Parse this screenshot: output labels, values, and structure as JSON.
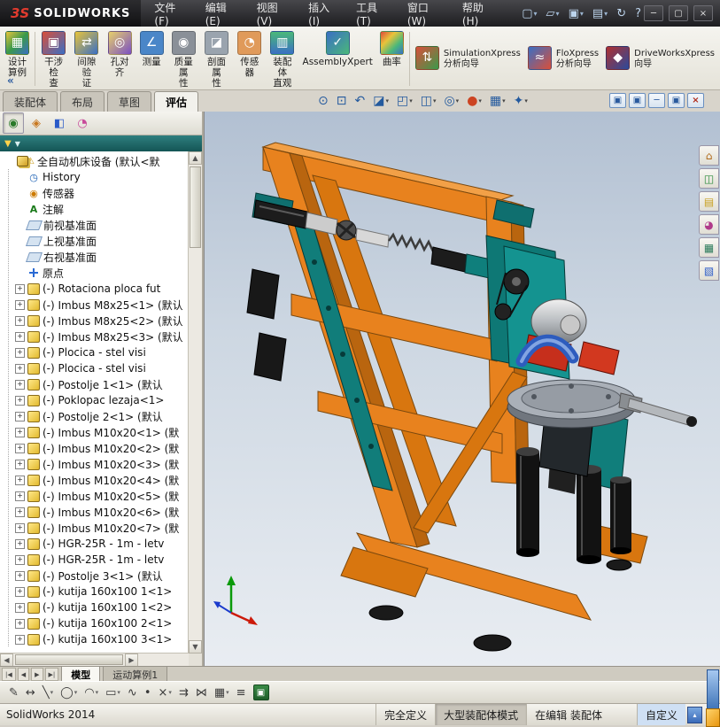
{
  "window": {
    "logo_mark": "3S",
    "logo_text": "SOLIDWORKS",
    "menus": [
      "文件(F)",
      "编辑(E)",
      "视图(V)",
      "插入(I)",
      "工具(T)",
      "窗口(W)",
      "帮助(H)"
    ],
    "quick_icons": [
      {
        "name": "new-document-button",
        "glyph": "▢",
        "caret": "▾"
      },
      {
        "name": "open-button",
        "glyph": "▱",
        "caret": "▾"
      },
      {
        "name": "save-button",
        "glyph": "▣",
        "caret": "▾"
      },
      {
        "name": "print-button",
        "glyph": "▤",
        "caret": "▾"
      },
      {
        "name": "rebuild-button",
        "glyph": "↻",
        "caret": ""
      },
      {
        "name": "help-button",
        "glyph": "?",
        "caret": ""
      }
    ],
    "window_buttons": [
      {
        "name": "minimize-button",
        "glyph": "─"
      },
      {
        "name": "maximize-button",
        "glyph": "▢"
      },
      {
        "name": "close-button",
        "glyph": "×"
      }
    ]
  },
  "ribbon": {
    "design_study": {
      "name": "design-study-button",
      "icon": "design-study-icon",
      "glyph": "▦",
      "label": "设计\n算例"
    },
    "collapse_glyph": "«",
    "buttons": [
      {
        "name": "interference-check-button",
        "icon": "interference-check-icon",
        "glyph": "▣",
        "label": "干涉检\n查"
      },
      {
        "name": "clearance-verify-button",
        "icon": "clearance-verify-icon",
        "glyph": "⇄",
        "label": "间隙验\n证"
      },
      {
        "name": "hole-alignment-button",
        "icon": "hole-alignment-icon",
        "glyph": "◎",
        "label": "孔对齐"
      },
      {
        "name": "measure-button",
        "icon": "measure-icon",
        "glyph": "∠",
        "label": "测量"
      },
      {
        "name": "mass-properties-button",
        "icon": "mass-properties-icon",
        "glyph": "◉",
        "label": "质量属\n性"
      },
      {
        "name": "section-properties-button",
        "icon": "section-properties-icon",
        "glyph": "◪",
        "label": "剖面属\n性"
      },
      {
        "name": "sensor-button",
        "icon": "sensor-icon",
        "glyph": "◔",
        "label": "传感器"
      },
      {
        "name": "assembly-visualization-button",
        "icon": "assembly-visualization-icon",
        "glyph": "▥",
        "label": "装配体\n直观"
      },
      {
        "name": "assemblyxpert-button",
        "icon": "assemblyxpert-icon",
        "glyph": "✓",
        "label": "AssemblyXpert"
      },
      {
        "name": "curvature-button",
        "icon": "curvature-icon",
        "glyph": "",
        "label": "曲率"
      }
    ],
    "xpress": [
      {
        "name": "simulationxpress-button",
        "icon": "simulationxpress-icon",
        "glyph": "⇅",
        "label": "SimulationXpress\n分析向导"
      },
      {
        "name": "floxpress-button",
        "icon": "floxpress-icon",
        "glyph": "≈",
        "label": "FloXpress\n分析向导"
      },
      {
        "name": "driveworksxpress-button",
        "icon": "driveworksxpress-icon",
        "glyph": "◆",
        "label": "DriveWorksXpress\n向导"
      }
    ]
  },
  "tabs": {
    "items": [
      {
        "name": "tab-assembly",
        "label": "装配体",
        "cls": ""
      },
      {
        "name": "tab-layout",
        "label": "布局",
        "cls": ""
      },
      {
        "name": "tab-sketch",
        "label": "草图",
        "cls": ""
      },
      {
        "name": "tab-evaluate",
        "label": "评估",
        "cls": "active"
      }
    ]
  },
  "viewport": {
    "hud": [
      {
        "name": "zoom-to-fit-button",
        "glyph": "⊙",
        "caret": "",
        "cls": ""
      },
      {
        "name": "zoom-to-area-button",
        "glyph": "⊡",
        "caret": "",
        "cls": ""
      },
      {
        "name": "previous-view-button",
        "glyph": "↶",
        "caret": "",
        "cls": ""
      },
      {
        "name": "section-view-button",
        "glyph": "◪",
        "caret": "▾",
        "cls": ""
      },
      {
        "name": "view-orientation-button",
        "glyph": "◰",
        "caret": "▾",
        "cls": ""
      },
      {
        "name": "display-style-button",
        "glyph": "◫",
        "caret": "▾",
        "cls": ""
      },
      {
        "name": "hide-show-items-button",
        "glyph": "◎",
        "caret": "▾",
        "cls": ""
      },
      {
        "name": "edit-appearance-button",
        "glyph": "●",
        "caret": "▾",
        "cls": "ball"
      },
      {
        "name": "apply-scene-button",
        "glyph": "▦",
        "caret": "▾",
        "cls": ""
      },
      {
        "name": "view-settings-button",
        "glyph": "✦",
        "caret": "▾",
        "cls": ""
      }
    ],
    "doc_buttons": [
      {
        "name": "restore-doc-button",
        "glyph": "▣",
        "cls": ""
      },
      {
        "name": "tile-doc-button",
        "glyph": "▣",
        "cls": ""
      },
      {
        "name": "minimize-doc-button",
        "glyph": "─",
        "cls": ""
      },
      {
        "name": "maximize-doc-button",
        "glyph": "▣",
        "cls": ""
      },
      {
        "name": "close-doc-button",
        "glyph": "×",
        "cls": "close"
      }
    ],
    "taskpane": [
      {
        "name": "solidworks-resources-tab",
        "glyph": "⌂",
        "cls": "tp1"
      },
      {
        "name": "design-library-tab",
        "glyph": "◫",
        "cls": "tp2"
      },
      {
        "name": "file-explorer-tab",
        "glyph": "▤",
        "cls": "tp3"
      },
      {
        "name": "appearances-tab",
        "glyph": "◕",
        "cls": "tp4"
      },
      {
        "name": "custom-properties-tab",
        "glyph": "▦",
        "cls": "tp5"
      },
      {
        "name": "view-palette-tab",
        "glyph": "▧",
        "cls": "tp6"
      }
    ]
  },
  "panel": {
    "tabs": [
      {
        "name": "featuremanager-tree-tab",
        "glyph": "◉",
        "cls": "c-green"
      },
      {
        "name": "propertymanager-tab",
        "glyph": "◈",
        "cls": "c-orange"
      },
      {
        "name": "configurationmanager-tab",
        "glyph": "◧",
        "cls": "c-blue"
      },
      {
        "name": "displaymanager-tab",
        "glyph": "◔",
        "cls": "c-multi"
      }
    ],
    "more_glyph": "»",
    "filter_funnel": "▼",
    "filter_caret": "▼"
  },
  "tree": {
    "items": [
      {
        "exp": "",
        "icon": "assembly",
        "warn": "⚠",
        "text": "全自动机床设备 (默认<默",
        "lvl": ""
      },
      {
        "exp": "",
        "icon": "history",
        "warn": "",
        "text": "History",
        "lvl": "child"
      },
      {
        "exp": "",
        "icon": "sensor",
        "warn": "",
        "text": "传感器",
        "lvl": "child"
      },
      {
        "exp": "",
        "icon": "annotation",
        "warn": "",
        "text": "注解",
        "lvl": "child"
      },
      {
        "exp": "",
        "icon": "plane",
        "warn": "",
        "text": "前视基准面",
        "lvl": "child"
      },
      {
        "exp": "",
        "icon": "plane",
        "warn": "",
        "text": "上视基准面",
        "lvl": "child"
      },
      {
        "exp": "",
        "icon": "plane",
        "warn": "",
        "text": "右视基准面",
        "lvl": "child"
      },
      {
        "exp": "",
        "icon": "origin",
        "warn": "",
        "text": "原点",
        "lvl": "child"
      },
      {
        "exp": "+",
        "icon": "part",
        "warn": "",
        "text": "(-) Rotaciona ploca fut",
        "lvl": "child"
      },
      {
        "exp": "+",
        "icon": "part",
        "warn": "",
        "text": "(-) Imbus M8x25<1> (默认",
        "lvl": "child"
      },
      {
        "exp": "+",
        "icon": "part",
        "warn": "",
        "text": "(-) Imbus M8x25<2> (默认",
        "lvl": "child"
      },
      {
        "exp": "+",
        "icon": "part",
        "warn": "",
        "text": "(-) Imbus M8x25<3> (默认",
        "lvl": "child"
      },
      {
        "exp": "+",
        "icon": "part",
        "warn": "",
        "text": "(-) Plocica - stel visi",
        "lvl": "child"
      },
      {
        "exp": "+",
        "icon": "part",
        "warn": "",
        "text": "(-) Plocica - stel visi",
        "lvl": "child"
      },
      {
        "exp": "+",
        "icon": "part",
        "warn": "",
        "text": "(-) Postolje 1<1> (默认",
        "lvl": "child"
      },
      {
        "exp": "+",
        "icon": "part",
        "warn": "",
        "text": "(-) Poklopac lezaja<1>",
        "lvl": "child"
      },
      {
        "exp": "+",
        "icon": "part",
        "warn": "",
        "text": "(-) Postolje 2<1> (默认",
        "lvl": "child"
      },
      {
        "exp": "+",
        "icon": "part",
        "warn": "",
        "text": "(-) Imbus M10x20<1> (默",
        "lvl": "child"
      },
      {
        "exp": "+",
        "icon": "part",
        "warn": "",
        "text": "(-) Imbus M10x20<2> (默",
        "lvl": "child"
      },
      {
        "exp": "+",
        "icon": "part",
        "warn": "",
        "text": "(-) Imbus M10x20<3> (默",
        "lvl": "child"
      },
      {
        "exp": "+",
        "icon": "part",
        "warn": "",
        "text": "(-) Imbus M10x20<4> (默",
        "lvl": "child"
      },
      {
        "exp": "+",
        "icon": "part",
        "warn": "",
        "text": "(-) Imbus M10x20<5> (默",
        "lvl": "child"
      },
      {
        "exp": "+",
        "icon": "part",
        "warn": "",
        "text": "(-) Imbus M10x20<6> (默",
        "lvl": "child"
      },
      {
        "exp": "+",
        "icon": "part",
        "warn": "",
        "text": "(-) Imbus M10x20<7> (默",
        "lvl": "child"
      },
      {
        "exp": "+",
        "icon": "part",
        "warn": "",
        "text": "(-) HGR-25R - 1m - letv",
        "lvl": "child"
      },
      {
        "exp": "+",
        "icon": "part",
        "warn": "",
        "text": "(-) HGR-25R - 1m - letv",
        "lvl": "child"
      },
      {
        "exp": "+",
        "icon": "part",
        "warn": "",
        "text": "(-) Postolje 3<1> (默认",
        "lvl": "child"
      },
      {
        "exp": "+",
        "icon": "part",
        "warn": "",
        "text": "(-) kutija 160x100 1<1>",
        "lvl": "child"
      },
      {
        "exp": "+",
        "icon": "part",
        "warn": "",
        "text": "(-) kutija 160x100 1<2>",
        "lvl": "child"
      },
      {
        "exp": "+",
        "icon": "part",
        "warn": "",
        "text": "(-) kutija 160x100 2<1>",
        "lvl": "child"
      },
      {
        "exp": "+",
        "icon": "part",
        "warn": "",
        "text": "(-) kutija 160x100 3<1>",
        "lvl": "child"
      }
    ]
  },
  "bottom": {
    "nav": [
      {
        "name": "first-tab-button",
        "glyph": "|◀"
      },
      {
        "name": "prev-tab-button",
        "glyph": "◀"
      },
      {
        "name": "next-tab-button",
        "glyph": "▶"
      },
      {
        "name": "last-tab-button",
        "glyph": "▶|"
      }
    ],
    "tabs": [
      {
        "name": "model-tab",
        "label": "模型",
        "cls": "active"
      },
      {
        "name": "motion-study-tab",
        "label": "运动算例1",
        "cls": ""
      }
    ]
  },
  "sketchbar": {
    "items": [
      {
        "name": "sketch-button",
        "glyph": "✎",
        "caret": "",
        "cls": ""
      },
      {
        "name": "smart-dimension-button",
        "glyph": "↔",
        "caret": "",
        "cls": ""
      },
      {
        "name": "line-tool-button",
        "glyph": "╲",
        "caret": "▾",
        "cls": ""
      },
      {
        "name": "circle-tool-button",
        "glyph": "◯",
        "caret": "▾",
        "cls": ""
      },
      {
        "name": "arc-tool-button",
        "glyph": "◠",
        "caret": "▾",
        "cls": ""
      },
      {
        "name": "rectangle-tool-button",
        "glyph": "▭",
        "caret": "▾",
        "cls": ""
      },
      {
        "name": "spline-tool-button",
        "glyph": "∿",
        "caret": "",
        "cls": ""
      },
      {
        "name": "point-tool-button",
        "glyph": "•",
        "caret": "",
        "cls": ""
      },
      {
        "name": "trim-entities-button",
        "glyph": "×",
        "caret": "▾",
        "cls": ""
      },
      {
        "name": "convert-entities-button",
        "glyph": "⇉",
        "caret": "",
        "cls": ""
      },
      {
        "name": "mirror-entities-button",
        "glyph": "⋈",
        "caret": "",
        "cls": ""
      },
      {
        "name": "linear-pattern-button",
        "glyph": "▦",
        "caret": "▾",
        "cls": ""
      },
      {
        "name": "offset-entities-button",
        "glyph": "≡",
        "caret": "",
        "cls": ""
      },
      {
        "name": "sketch-settings-button",
        "glyph": "▣",
        "caret": "",
        "cls": "green"
      }
    ]
  },
  "status": {
    "app_name": "SolidWorks 2014",
    "define_state": "完全定义",
    "mode": "大型装配体模式",
    "editing": "在编辑 装配体",
    "custom": "自定义",
    "custom_caret": "▴"
  },
  "colors": {
    "frame_orange": "#E8821E",
    "machine_teal": "#11807C",
    "viewport_top": "#B2C0D2",
    "accent_blue": "#3F74B8"
  }
}
